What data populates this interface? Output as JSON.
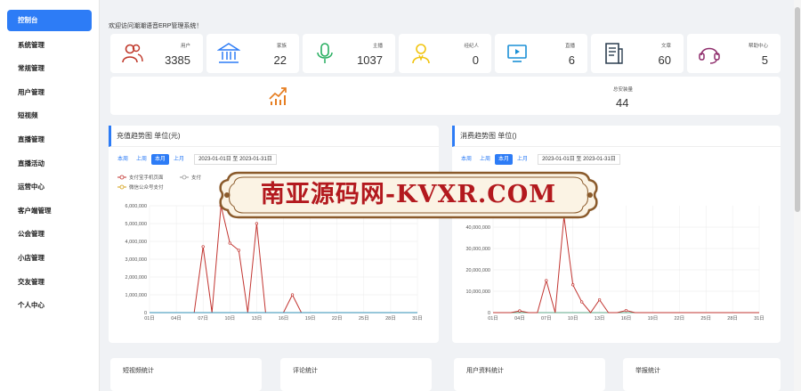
{
  "sidebar": {
    "items": [
      {
        "label": "控制台",
        "active": true
      },
      {
        "label": "系统管理"
      },
      {
        "label": "常规管理"
      },
      {
        "label": "用户管理"
      },
      {
        "label": "短视频"
      },
      {
        "label": "直播管理"
      },
      {
        "label": "直播活动"
      },
      {
        "label": "运营中心"
      },
      {
        "label": "客户端管理"
      },
      {
        "label": "公会管理"
      },
      {
        "label": "小店管理"
      },
      {
        "label": "交友管理"
      },
      {
        "label": "个人中心"
      }
    ]
  },
  "welcome": "欢迎访问潮潮语音ERP管理系统！",
  "stats": [
    {
      "label": "用户",
      "value": "3385",
      "icon": "users-icon",
      "color": "#c0392b"
    },
    {
      "label": "家族",
      "value": "22",
      "icon": "bank-icon",
      "color": "#2d7cf6"
    },
    {
      "label": "主播",
      "value": "1037",
      "icon": "microphone-icon",
      "color": "#27ae60"
    },
    {
      "label": "经纪人",
      "value": "0",
      "icon": "agent-icon",
      "color": "#f1c40f"
    },
    {
      "label": "直播",
      "value": "6",
      "icon": "play-screen-icon",
      "color": "#1a8fd6"
    },
    {
      "label": "文章",
      "value": "60",
      "icon": "article-icon",
      "color": "#2c3e50"
    },
    {
      "label": "帮助中心",
      "value": "5",
      "icon": "headset-icon",
      "color": "#8e2c6b"
    }
  ],
  "install": {
    "label": "总安装量",
    "value": "44",
    "icon": "trend-up-icon",
    "color": "#e67e22"
  },
  "recharge": {
    "title": "充值趋势图 单位(元)",
    "tabs": [
      "本周",
      "上周",
      "本月",
      "上月"
    ],
    "active_tab": "本月",
    "daterange": "2023-01-01日 至 2023-01-31日",
    "legend": [
      "支付宝手机页面",
      "支付",
      "微信公众号支付"
    ]
  },
  "consume": {
    "title": "消费趋势图 单位()",
    "tabs": [
      "本周",
      "上周",
      "本月",
      "上月"
    ],
    "active_tab": "本月",
    "daterange": "2023-01-01日 至 2023-01-31日",
    "legend": [
      "观看付费直播",
      "封面之星投票",
      "砸金蛋"
    ]
  },
  "bottom_cards": [
    "短视频统计",
    "评论统计",
    "用户资料统计",
    "举报统计"
  ],
  "watermark": "南亚源码网-KVXR.COM",
  "chart_data": [
    {
      "type": "line",
      "title": "充值趋势图 单位(元)",
      "x": [
        "01日",
        "02日",
        "03日",
        "04日",
        "05日",
        "06日",
        "07日",
        "08日",
        "09日",
        "10日",
        "11日",
        "12日",
        "13日",
        "14日",
        "15日",
        "16日",
        "17日",
        "18日",
        "19日",
        "20日",
        "21日",
        "22日",
        "23日",
        "24日",
        "25日",
        "26日",
        "27日",
        "28日",
        "29日",
        "30日",
        "31日"
      ],
      "x_ticks": [
        "01日",
        "04日",
        "07日",
        "10日",
        "13日",
        "16日",
        "19日",
        "22日",
        "25日",
        "28日",
        "31日"
      ],
      "y_ticks": [
        "0",
        "1,000,000",
        "2,000,000",
        "3,000,000",
        "4,000,000",
        "5,000,000",
        "6,000,000"
      ],
      "ylim": [
        0,
        6000000
      ],
      "series": [
        {
          "name": "支付宝手机页面",
          "color": "#c23531",
          "values": [
            0,
            0,
            0,
            0,
            0,
            0,
            3700000,
            0,
            6000000,
            3900000,
            3500000,
            0,
            5000000,
            0,
            0,
            0,
            1000000,
            0,
            0,
            0,
            0,
            0,
            0,
            0,
            0,
            0,
            0,
            0,
            0,
            0,
            0
          ]
        },
        {
          "name": "微信公众号支付",
          "color": "#d4a017",
          "values": [
            0,
            0,
            0,
            0,
            0,
            0,
            0,
            0,
            0,
            0,
            0,
            0,
            0,
            0,
            0,
            0,
            0,
            0,
            0,
            0,
            0,
            0,
            0,
            0,
            0,
            0,
            0,
            0,
            0,
            0,
            0
          ]
        },
        {
          "color": "#2f8fb6",
          "values": [
            0,
            0,
            0,
            0,
            0,
            0,
            0,
            0,
            0,
            0,
            0,
            0,
            0,
            0,
            0,
            0,
            0,
            0,
            0,
            0,
            0,
            0,
            0,
            0,
            0,
            0,
            0,
            0,
            0,
            0,
            0
          ]
        }
      ]
    },
    {
      "type": "line",
      "title": "消费趋势图 单位()",
      "x": [
        "01日",
        "02日",
        "03日",
        "04日",
        "05日",
        "06日",
        "07日",
        "08日",
        "09日",
        "10日",
        "11日",
        "12日",
        "13日",
        "14日",
        "15日",
        "16日",
        "17日",
        "18日",
        "19日",
        "20日",
        "21日",
        "22日",
        "23日",
        "24日",
        "25日",
        "26日",
        "27日",
        "28日",
        "29日",
        "30日",
        "31日"
      ],
      "x_ticks": [
        "01日",
        "04日",
        "07日",
        "10日",
        "13日",
        "16日",
        "19日",
        "22日",
        "25日",
        "28日",
        "31日"
      ],
      "y_ticks": [
        "0",
        "10,000,000",
        "20,000,000",
        "30,000,000",
        "40,000,000"
      ],
      "ylim": [
        0,
        50000000
      ],
      "series": [
        {
          "name": "观看付费直播",
          "color": "#2f8fb6",
          "values": [
            0,
            0,
            0,
            0,
            0,
            0,
            0,
            0,
            0,
            0,
            0,
            0,
            0,
            0,
            0,
            0,
            0,
            0,
            0,
            0,
            0,
            0,
            0,
            0,
            0,
            0,
            0,
            0,
            0,
            0,
            0
          ]
        },
        {
          "name": "封面之星投票",
          "color": "#2d7cf6",
          "values": [
            0,
            0,
            0,
            0,
            0,
            0,
            0,
            0,
            0,
            0,
            0,
            0,
            0,
            0,
            0,
            0,
            0,
            0,
            0,
            0,
            0,
            0,
            0,
            0,
            0,
            0,
            0,
            0,
            0,
            0,
            0
          ]
        },
        {
          "name": "砸金蛋",
          "color": "#5fa88a",
          "values": [
            0,
            0,
            0,
            0,
            0,
            0,
            0,
            0,
            0,
            0,
            0,
            0,
            0,
            0,
            0,
            0,
            0,
            0,
            0,
            0,
            0,
            0,
            0,
            0,
            0,
            0,
            0,
            0,
            0,
            0,
            0
          ]
        },
        {
          "color": "#c23531",
          "values": [
            0,
            0,
            0,
            800000,
            0,
            0,
            15000000,
            0,
            45000000,
            13000000,
            5000000,
            0,
            6000000,
            0,
            0,
            1000000,
            0,
            0,
            0,
            0,
            0,
            0,
            0,
            0,
            0,
            0,
            0,
            0,
            0,
            0,
            0
          ]
        }
      ]
    }
  ]
}
